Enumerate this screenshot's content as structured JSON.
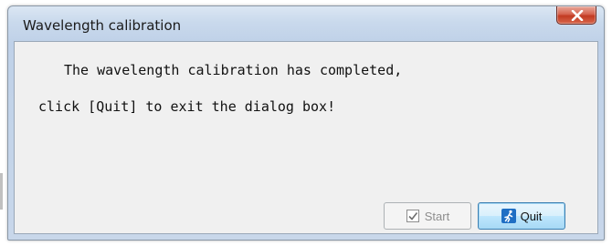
{
  "window": {
    "title": "Wavelength calibration"
  },
  "message": {
    "line1": "The wavelength calibration has completed,",
    "line2": "click [Quit] to exit the dialog box!"
  },
  "buttons": {
    "start_label": "Start",
    "start_enabled": false,
    "quit_label": "Quit"
  },
  "icons": {
    "close": "close-icon",
    "start": "checkbox-check-icon",
    "quit": "running-person-exit-icon"
  }
}
